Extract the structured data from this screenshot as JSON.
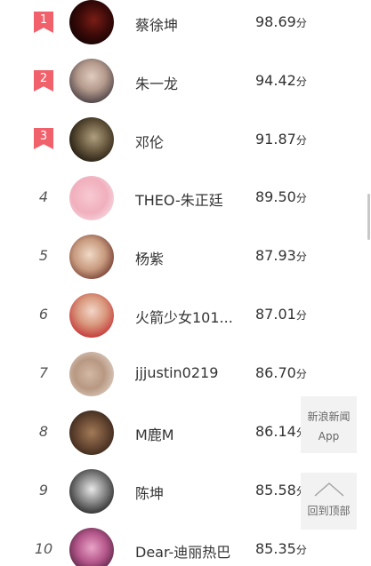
{
  "score_unit": "分",
  "ranking": [
    {
      "rank": "1",
      "name": "蔡徐坤",
      "score": "98.69",
      "top": true
    },
    {
      "rank": "2",
      "name": "朱一龙",
      "score": "94.42",
      "top": true
    },
    {
      "rank": "3",
      "name": "邓伦",
      "score": "91.87",
      "top": true
    },
    {
      "rank": "4",
      "name": "THEO-朱正廷",
      "score": "89.50",
      "top": false
    },
    {
      "rank": "5",
      "name": "杨紫",
      "score": "87.93",
      "top": false
    },
    {
      "rank": "6",
      "name": "火箭少女101...",
      "score": "87.01",
      "top": false
    },
    {
      "rank": "7",
      "name": "jjjustin0219",
      "score": "86.70",
      "top": false
    },
    {
      "rank": "8",
      "name": "M鹿M",
      "score": "86.14",
      "top": false
    },
    {
      "rank": "9",
      "name": "陈坤",
      "score": "85.58",
      "top": false
    },
    {
      "rank": "10",
      "name": "Dear-迪丽热巴",
      "score": "85.35",
      "top": false
    }
  ],
  "floating": {
    "app_line1": "新浪新闻",
    "app_line2": "App",
    "back_to_top": "回到顶部",
    "back_to_top_icon": "chevron-up-icon"
  },
  "colors": {
    "badge": "#f0616b",
    "text": "#333333",
    "rank_number": "#555555",
    "float_bg": "#f2f2f2"
  }
}
